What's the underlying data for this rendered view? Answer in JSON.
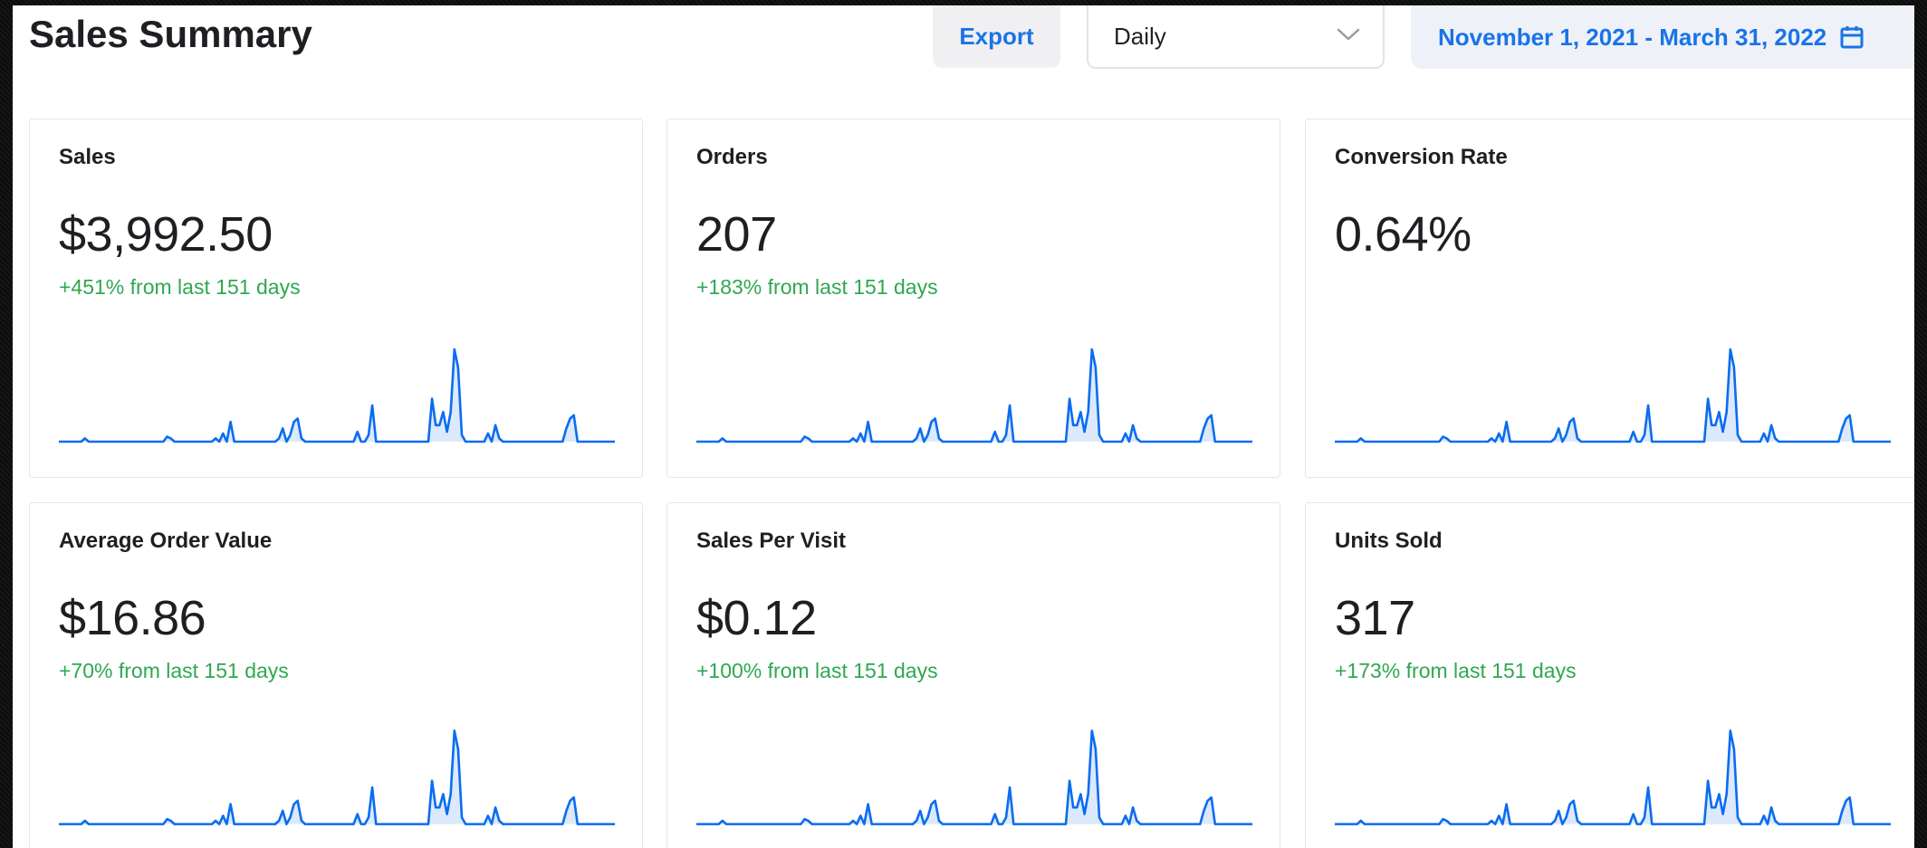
{
  "header": {
    "title": "Sales Summary",
    "export_label": "Export",
    "period_select": {
      "value": "Daily",
      "icon": "chevron-down-icon"
    },
    "date_range": {
      "label": "November 1, 2021 - March 31, 2022",
      "icon": "calendar-icon"
    }
  },
  "colors": {
    "accent": "#1a73e8",
    "line": "#0a6cf0",
    "fill": "#dbe9fb",
    "positive": "#2fa84f"
  },
  "cards": [
    {
      "label": "Sales",
      "value": "$3,992.50",
      "change": "+451% from last 151 days",
      "sparkline": [
        0,
        0,
        0,
        0,
        0,
        0,
        0,
        2,
        0,
        0,
        0,
        0,
        0,
        0,
        0,
        0,
        0,
        0,
        0,
        0,
        0,
        0,
        0,
        0,
        0,
        0,
        0,
        0,
        0,
        3,
        2,
        0,
        0,
        0,
        0,
        0,
        0,
        0,
        0,
        0,
        0,
        0,
        2,
        0,
        5,
        0,
        12,
        0,
        0,
        0,
        0,
        0,
        0,
        0,
        0,
        0,
        0,
        0,
        0,
        2,
        8,
        0,
        4,
        12,
        14,
        2,
        0,
        0,
        0,
        0,
        0,
        0,
        0,
        0,
        0,
        0,
        0,
        0,
        0,
        0,
        6,
        0,
        0,
        4,
        22,
        0,
        0,
        0,
        0,
        0,
        0,
        0,
        0,
        0,
        0,
        0,
        0,
        0,
        0,
        0,
        26,
        10,
        10,
        18,
        6,
        18,
        56,
        45,
        4,
        0,
        0,
        0,
        0,
        0,
        0,
        5,
        0,
        10,
        2,
        0,
        0,
        0,
        0,
        0,
        0,
        0,
        0,
        0,
        0,
        0,
        0,
        0,
        0,
        0,
        0,
        0,
        8,
        14,
        16,
        0,
        0,
        0,
        0,
        0,
        0,
        0,
        0,
        0,
        0,
        0
      ]
    },
    {
      "label": "Orders",
      "value": "207",
      "change": "+183% from last 151 days",
      "sparkline": [
        0,
        0,
        0,
        0,
        0,
        0,
        0,
        2,
        0,
        0,
        0,
        0,
        0,
        0,
        0,
        0,
        0,
        0,
        0,
        0,
        0,
        0,
        0,
        0,
        0,
        0,
        0,
        0,
        0,
        3,
        2,
        0,
        0,
        0,
        0,
        0,
        0,
        0,
        0,
        0,
        0,
        0,
        2,
        0,
        5,
        0,
        12,
        0,
        0,
        0,
        0,
        0,
        0,
        0,
        0,
        0,
        0,
        0,
        0,
        2,
        8,
        0,
        4,
        12,
        14,
        2,
        0,
        0,
        0,
        0,
        0,
        0,
        0,
        0,
        0,
        0,
        0,
        0,
        0,
        0,
        6,
        0,
        0,
        4,
        22,
        0,
        0,
        0,
        0,
        0,
        0,
        0,
        0,
        0,
        0,
        0,
        0,
        0,
        0,
        0,
        26,
        10,
        10,
        18,
        6,
        18,
        56,
        45,
        4,
        0,
        0,
        0,
        0,
        0,
        0,
        5,
        0,
        10,
        2,
        0,
        0,
        0,
        0,
        0,
        0,
        0,
        0,
        0,
        0,
        0,
        0,
        0,
        0,
        0,
        0,
        0,
        8,
        14,
        16,
        0,
        0,
        0,
        0,
        0,
        0,
        0,
        0,
        0,
        0,
        0
      ]
    },
    {
      "label": "Conversion Rate",
      "value": "0.64%",
      "change": "",
      "sparkline": [
        0,
        0,
        0,
        0,
        0,
        0,
        0,
        2,
        0,
        0,
        0,
        0,
        0,
        0,
        0,
        0,
        0,
        0,
        0,
        0,
        0,
        0,
        0,
        0,
        0,
        0,
        0,
        0,
        0,
        3,
        2,
        0,
        0,
        0,
        0,
        0,
        0,
        0,
        0,
        0,
        0,
        0,
        2,
        0,
        5,
        0,
        12,
        0,
        0,
        0,
        0,
        0,
        0,
        0,
        0,
        0,
        0,
        0,
        0,
        2,
        8,
        0,
        4,
        12,
        14,
        2,
        0,
        0,
        0,
        0,
        0,
        0,
        0,
        0,
        0,
        0,
        0,
        0,
        0,
        0,
        6,
        0,
        0,
        4,
        22,
        0,
        0,
        0,
        0,
        0,
        0,
        0,
        0,
        0,
        0,
        0,
        0,
        0,
        0,
        0,
        26,
        10,
        10,
        18,
        6,
        18,
        56,
        45,
        4,
        0,
        0,
        0,
        0,
        0,
        0,
        5,
        0,
        10,
        2,
        0,
        0,
        0,
        0,
        0,
        0,
        0,
        0,
        0,
        0,
        0,
        0,
        0,
        0,
        0,
        0,
        0,
        8,
        14,
        16,
        0,
        0,
        0,
        0,
        0,
        0,
        0,
        0,
        0,
        0,
        0
      ]
    },
    {
      "label": "Average Order Value",
      "value": "$16.86",
      "change": "+70% from last 151 days",
      "sparkline": [
        0,
        0,
        0,
        0,
        0,
        0,
        0,
        2,
        0,
        0,
        0,
        0,
        0,
        0,
        0,
        0,
        0,
        0,
        0,
        0,
        0,
        0,
        0,
        0,
        0,
        0,
        0,
        0,
        0,
        3,
        2,
        0,
        0,
        0,
        0,
        0,
        0,
        0,
        0,
        0,
        0,
        0,
        2,
        0,
        5,
        0,
        12,
        0,
        0,
        0,
        0,
        0,
        0,
        0,
        0,
        0,
        0,
        0,
        0,
        2,
        8,
        0,
        4,
        12,
        14,
        2,
        0,
        0,
        0,
        0,
        0,
        0,
        0,
        0,
        0,
        0,
        0,
        0,
        0,
        0,
        6,
        0,
        0,
        4,
        22,
        0,
        0,
        0,
        0,
        0,
        0,
        0,
        0,
        0,
        0,
        0,
        0,
        0,
        0,
        0,
        26,
        10,
        10,
        18,
        6,
        18,
        56,
        45,
        4,
        0,
        0,
        0,
        0,
        0,
        0,
        5,
        0,
        10,
        2,
        0,
        0,
        0,
        0,
        0,
        0,
        0,
        0,
        0,
        0,
        0,
        0,
        0,
        0,
        0,
        0,
        0,
        8,
        14,
        16,
        0,
        0,
        0,
        0,
        0,
        0,
        0,
        0,
        0,
        0,
        0
      ]
    },
    {
      "label": "Sales Per Visit",
      "value": "$0.12",
      "change": "+100% from last 151 days",
      "sparkline": [
        0,
        0,
        0,
        0,
        0,
        0,
        0,
        2,
        0,
        0,
        0,
        0,
        0,
        0,
        0,
        0,
        0,
        0,
        0,
        0,
        0,
        0,
        0,
        0,
        0,
        0,
        0,
        0,
        0,
        3,
        2,
        0,
        0,
        0,
        0,
        0,
        0,
        0,
        0,
        0,
        0,
        0,
        2,
        0,
        5,
        0,
        12,
        0,
        0,
        0,
        0,
        0,
        0,
        0,
        0,
        0,
        0,
        0,
        0,
        2,
        8,
        0,
        4,
        12,
        14,
        2,
        0,
        0,
        0,
        0,
        0,
        0,
        0,
        0,
        0,
        0,
        0,
        0,
        0,
        0,
        6,
        0,
        0,
        4,
        22,
        0,
        0,
        0,
        0,
        0,
        0,
        0,
        0,
        0,
        0,
        0,
        0,
        0,
        0,
        0,
        26,
        10,
        10,
        18,
        6,
        18,
        56,
        45,
        4,
        0,
        0,
        0,
        0,
        0,
        0,
        5,
        0,
        10,
        2,
        0,
        0,
        0,
        0,
        0,
        0,
        0,
        0,
        0,
        0,
        0,
        0,
        0,
        0,
        0,
        0,
        0,
        8,
        14,
        16,
        0,
        0,
        0,
        0,
        0,
        0,
        0,
        0,
        0,
        0,
        0
      ]
    },
    {
      "label": "Units Sold",
      "value": "317",
      "change": "+173% from last 151 days",
      "sparkline": [
        0,
        0,
        0,
        0,
        0,
        0,
        0,
        2,
        0,
        0,
        0,
        0,
        0,
        0,
        0,
        0,
        0,
        0,
        0,
        0,
        0,
        0,
        0,
        0,
        0,
        0,
        0,
        0,
        0,
        3,
        2,
        0,
        0,
        0,
        0,
        0,
        0,
        0,
        0,
        0,
        0,
        0,
        2,
        0,
        5,
        0,
        12,
        0,
        0,
        0,
        0,
        0,
        0,
        0,
        0,
        0,
        0,
        0,
        0,
        2,
        8,
        0,
        4,
        12,
        14,
        2,
        0,
        0,
        0,
        0,
        0,
        0,
        0,
        0,
        0,
        0,
        0,
        0,
        0,
        0,
        6,
        0,
        0,
        4,
        22,
        0,
        0,
        0,
        0,
        0,
        0,
        0,
        0,
        0,
        0,
        0,
        0,
        0,
        0,
        0,
        26,
        10,
        10,
        18,
        6,
        18,
        56,
        45,
        4,
        0,
        0,
        0,
        0,
        0,
        0,
        5,
        0,
        10,
        2,
        0,
        0,
        0,
        0,
        0,
        0,
        0,
        0,
        0,
        0,
        0,
        0,
        0,
        0,
        0,
        0,
        0,
        8,
        14,
        16,
        0,
        0,
        0,
        0,
        0,
        0,
        0,
        0,
        0,
        0,
        0
      ]
    }
  ]
}
